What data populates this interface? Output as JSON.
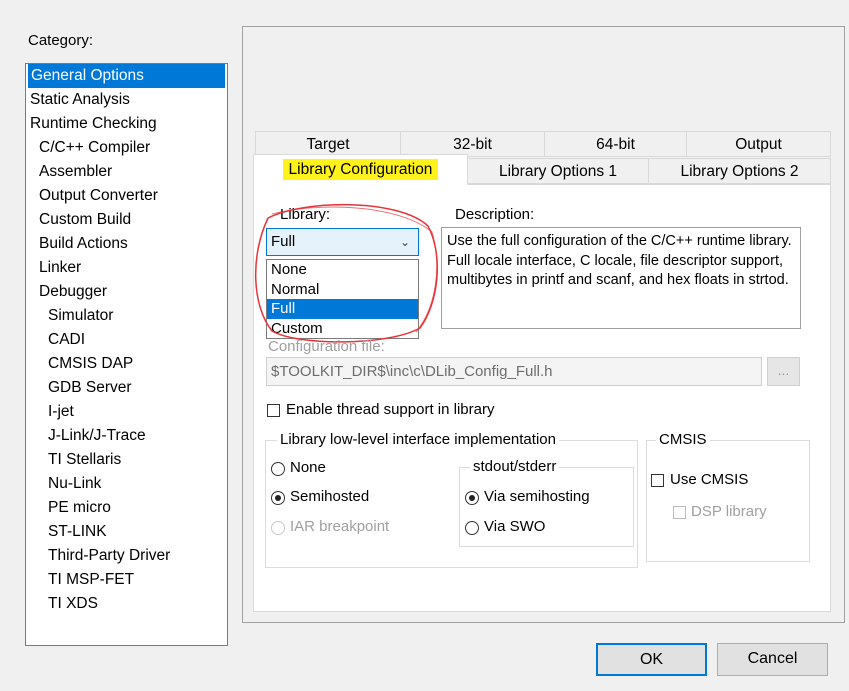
{
  "category": {
    "label": "Category:",
    "items": [
      {
        "label": "General Options",
        "level": 0,
        "selected": true
      },
      {
        "label": "Static Analysis",
        "level": 0
      },
      {
        "label": "Runtime Checking",
        "level": 0
      },
      {
        "label": "C/C++ Compiler",
        "level": 1
      },
      {
        "label": "Assembler",
        "level": 1
      },
      {
        "label": "Output Converter",
        "level": 1
      },
      {
        "label": "Custom Build",
        "level": 1
      },
      {
        "label": "Build Actions",
        "level": 1
      },
      {
        "label": "Linker",
        "level": 1
      },
      {
        "label": "Debugger",
        "level": 1
      },
      {
        "label": "Simulator",
        "level": 2
      },
      {
        "label": "CADI",
        "level": 2
      },
      {
        "label": "CMSIS DAP",
        "level": 2
      },
      {
        "label": "GDB Server",
        "level": 2
      },
      {
        "label": "I-jet",
        "level": 2
      },
      {
        "label": "J-Link/J-Trace",
        "level": 2
      },
      {
        "label": "TI Stellaris",
        "level": 2
      },
      {
        "label": "Nu-Link",
        "level": 2
      },
      {
        "label": "PE micro",
        "level": 2
      },
      {
        "label": "ST-LINK",
        "level": 2
      },
      {
        "label": "Third-Party Driver",
        "level": 2
      },
      {
        "label": "TI MSP-FET",
        "level": 2
      },
      {
        "label": "TI XDS",
        "level": 2
      }
    ]
  },
  "tabs": {
    "row1": [
      "Target",
      "32-bit",
      "64-bit",
      "Output"
    ],
    "row2": [
      "Library Configuration",
      "Library Options 1",
      "Library Options 2"
    ],
    "active": "Library Configuration"
  },
  "library": {
    "label": "Library:",
    "selected": "Full",
    "options": [
      "None",
      "Normal",
      "Full",
      "Custom"
    ],
    "chevron_icon": "chevron-down-icon"
  },
  "description": {
    "label": "Description:",
    "text": "Use the full configuration of the C/C++ runtime library. Full locale interface, C locale, file descriptor support, multibytes in printf and scanf, and hex floats in strtod."
  },
  "config_file": {
    "label": "Configuration file:",
    "value": "$TOOLKIT_DIR$\\inc\\c\\DLib_Config_Full.h",
    "browse_label": "..."
  },
  "thread_support": {
    "label": "Enable thread support in library",
    "checked": false
  },
  "low_level": {
    "title": "Library low-level interface implementation",
    "options": [
      {
        "label": "None",
        "checked": false,
        "disabled": false
      },
      {
        "label": "Semihosted",
        "checked": true,
        "disabled": false
      },
      {
        "label": "IAR breakpoint",
        "checked": false,
        "disabled": true
      }
    ],
    "stdout": {
      "title": "stdout/stderr",
      "options": [
        {
          "label": "Via semihosting",
          "checked": true
        },
        {
          "label": "Via SWO",
          "checked": false
        }
      ]
    }
  },
  "cmsis": {
    "title": "CMSIS",
    "use_cmsis": "Use CMSIS",
    "dsp_library": "DSP library"
  },
  "buttons": {
    "ok": "OK",
    "cancel": "Cancel"
  },
  "colors": {
    "selection": "#0078d7",
    "highlight": "#fff21a",
    "annotation_circle": "#e8333a"
  }
}
